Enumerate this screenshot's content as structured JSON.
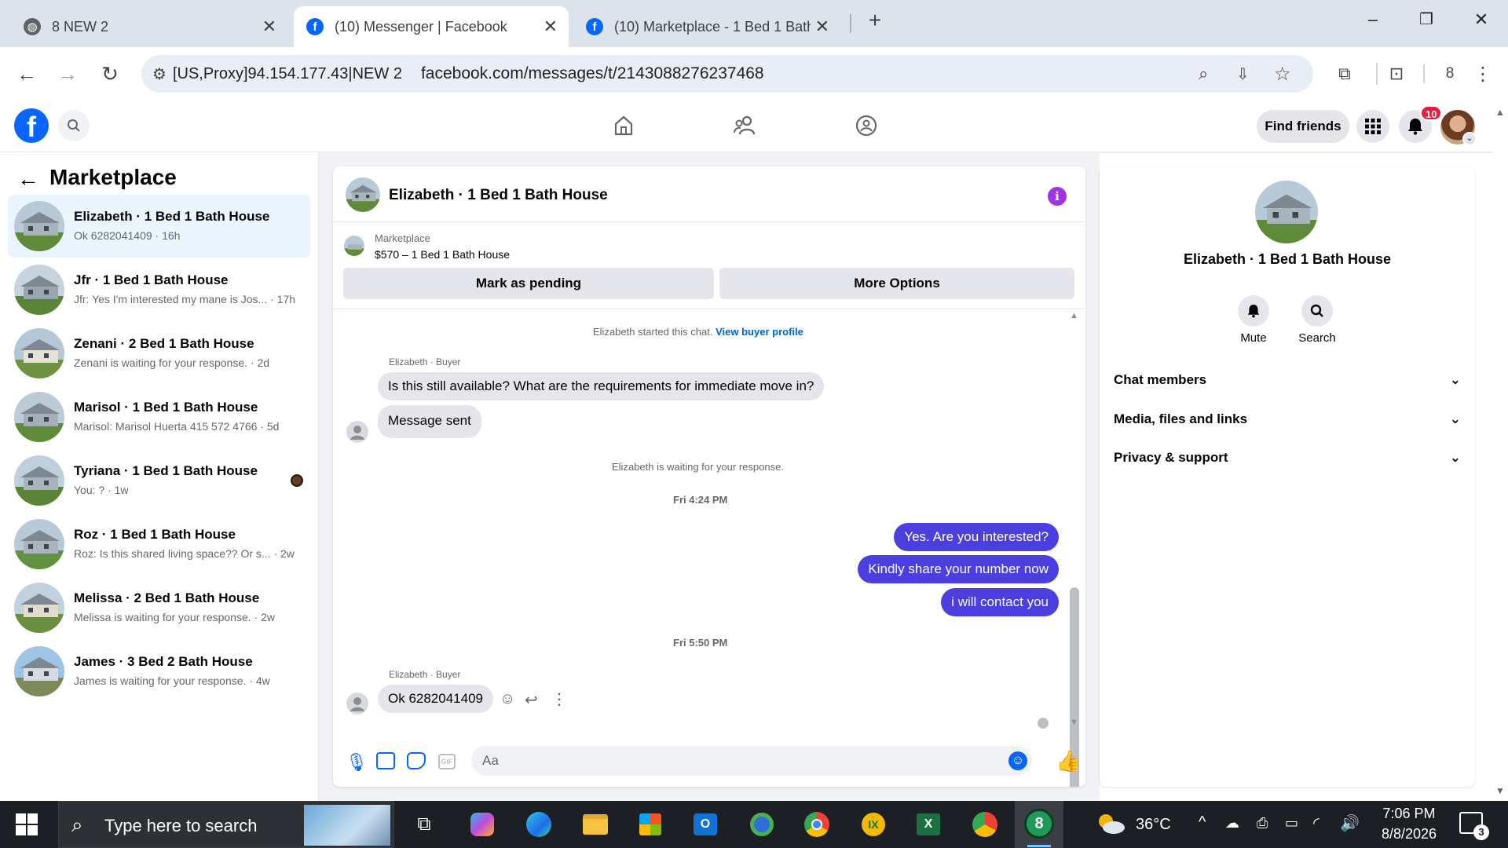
{
  "browser": {
    "tabs": [
      {
        "title": "8 NEW 2",
        "active": false
      },
      {
        "title": "(10) Messenger | Facebook",
        "active": true
      },
      {
        "title": "(10) Marketplace - 1 Bed 1 Bath",
        "active": false
      }
    ],
    "new_tab": "+",
    "window_controls": {
      "minimize": "–",
      "restore": "❐",
      "close": "✕"
    },
    "proxy_label": "[US,Proxy]94.154.177.43|NEW 2",
    "url": "facebook.com/messages/t/2143088276237468",
    "profile_count": "8"
  },
  "fb_header": {
    "find_friends": "Find friends",
    "notification_count": "10"
  },
  "sidebar": {
    "title": "Marketplace",
    "conversations": [
      {
        "name": "Elizabeth · 1 Bed 1 Bath House",
        "preview": "Ok 6282041409 · 16h",
        "selected": true
      },
      {
        "name": "Jfr · 1 Bed 1 Bath House",
        "preview": "Jfr: Yes I'm interested my mane is Jos... · 17h"
      },
      {
        "name": "Zenani · 2 Bed 1 Bath House",
        "preview": "Zenani is waiting for your response. · 2d"
      },
      {
        "name": "Marisol · 1 Bed 1 Bath House",
        "preview": "Marisol: Marisol Huerta 415 572 4766 · 5d"
      },
      {
        "name": "Tyriana · 1 Bed 1 Bath House",
        "preview": "You: ? · 1w"
      },
      {
        "name": "Roz · 1 Bed 1 Bath House",
        "preview": "Roz: Is this shared living space?? Or s... · 2w"
      },
      {
        "name": "Melissa · 2 Bed 1 Bath House",
        "preview": "Melissa is waiting for your response. · 2w"
      },
      {
        "name": "James · 3 Bed 2 Bath House",
        "preview": "James is waiting for your response. · 4w"
      }
    ]
  },
  "chat": {
    "title": "Elizabeth · 1 Bed 1 Bath House",
    "listing_source": "Marketplace",
    "listing_title": "$570 – 1 Bed 1 Bath House",
    "mark_pending": "Mark as pending",
    "more_options": "More Options",
    "started_text": "Elizabeth started this chat.",
    "view_buyer": "View buyer profile",
    "sender_label": "Elizabeth · Buyer",
    "msg1": "Is this still available? What are the requirements for immediate move in?",
    "msg2": "Message sent",
    "waiting_text": "Elizabeth is waiting for your response.",
    "time1": "Fri 4:24 PM",
    "out1": "Yes. Are you interested?",
    "out2": "Kindly share your number now",
    "out3": "i will contact you",
    "time2": "Fri 5:50 PM",
    "sender_label2": "Elizabeth · Buyer",
    "msg3": "Ok 6282041409",
    "composer_placeholder": "Aa"
  },
  "info_panel": {
    "name": "Elizabeth · 1 Bed 1 Bath House",
    "mute": "Mute",
    "search": "Search",
    "sections": [
      "Chat members",
      "Media, files and links",
      "Privacy & support"
    ]
  },
  "taskbar": {
    "search_placeholder": "Type here to search",
    "temperature": "36°C",
    "time": "7:06 PM",
    "date": "8/8/2026",
    "notification_badge": "3"
  },
  "colors": {
    "fb_blue": "#0866ff",
    "outgoing_bubble": "#4b3fe0",
    "selected_row": "#ebf5ff",
    "info_icon": "#a033e6"
  }
}
